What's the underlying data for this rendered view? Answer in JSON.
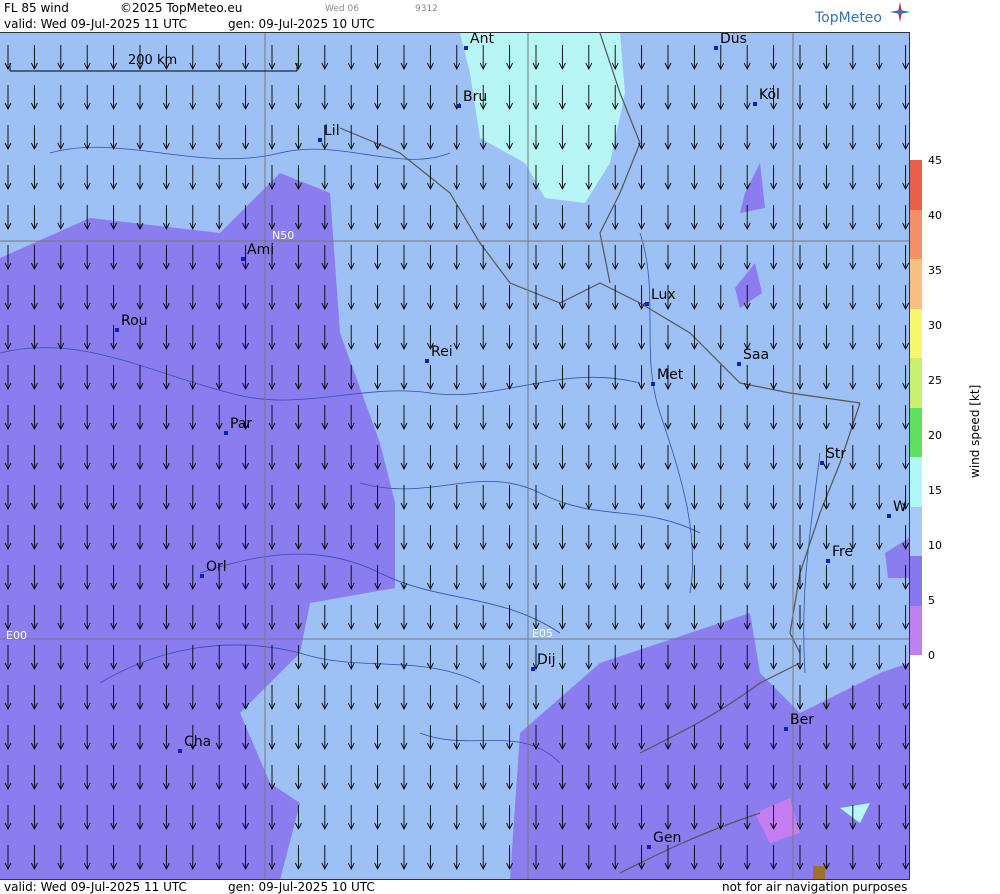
{
  "header": {
    "product": "FL 85 wind",
    "copyright": "©2025 TopMeteo.eu",
    "day_code": "Wed 06",
    "code": "9312",
    "valid": "valid:  Wed  09-Jul-2025  11 UTC",
    "gen": "gen: 09-Jul-2025 10 UTC",
    "brand": "TopMeteo"
  },
  "footer": {
    "valid": "valid:  Wed  09-Jul-2025  11 UTC",
    "gen": "gen: 09-Jul-2025 10 UTC",
    "notice": "not for air navigation purposes"
  },
  "scale_bar": "200 km",
  "grid_labels": {
    "n50": "N50",
    "e00": "E00",
    "e05": "E05"
  },
  "cities": [
    "Ant",
    "Düs",
    "Bru",
    "Köl",
    "Lil",
    "Ami",
    "Rou",
    "Lux",
    "Rei",
    "Saa",
    "Met",
    "Par",
    "Str",
    "W",
    "Fre",
    "Orl",
    "Dij",
    "Ber",
    "Cha",
    "Gen"
  ],
  "colorbar": {
    "label": "wind  speed  [kt]",
    "ticks": [
      "45",
      "40",
      "35",
      "30",
      "25",
      "20",
      "15",
      "10",
      "5",
      "0"
    ],
    "colors": [
      "#e8604c",
      "#f4906a",
      "#f8c080",
      "#f8f870",
      "#c8f070",
      "#60e060",
      "#b0f8f8",
      "#a8c8f8",
      "#8878f0",
      "#c080f0"
    ]
  },
  "colors": {
    "light_blue": "#9dc0f5",
    "purple": "#8b7cf0",
    "cyan": "#b6f7f5",
    "violet": "#c77df2"
  }
}
